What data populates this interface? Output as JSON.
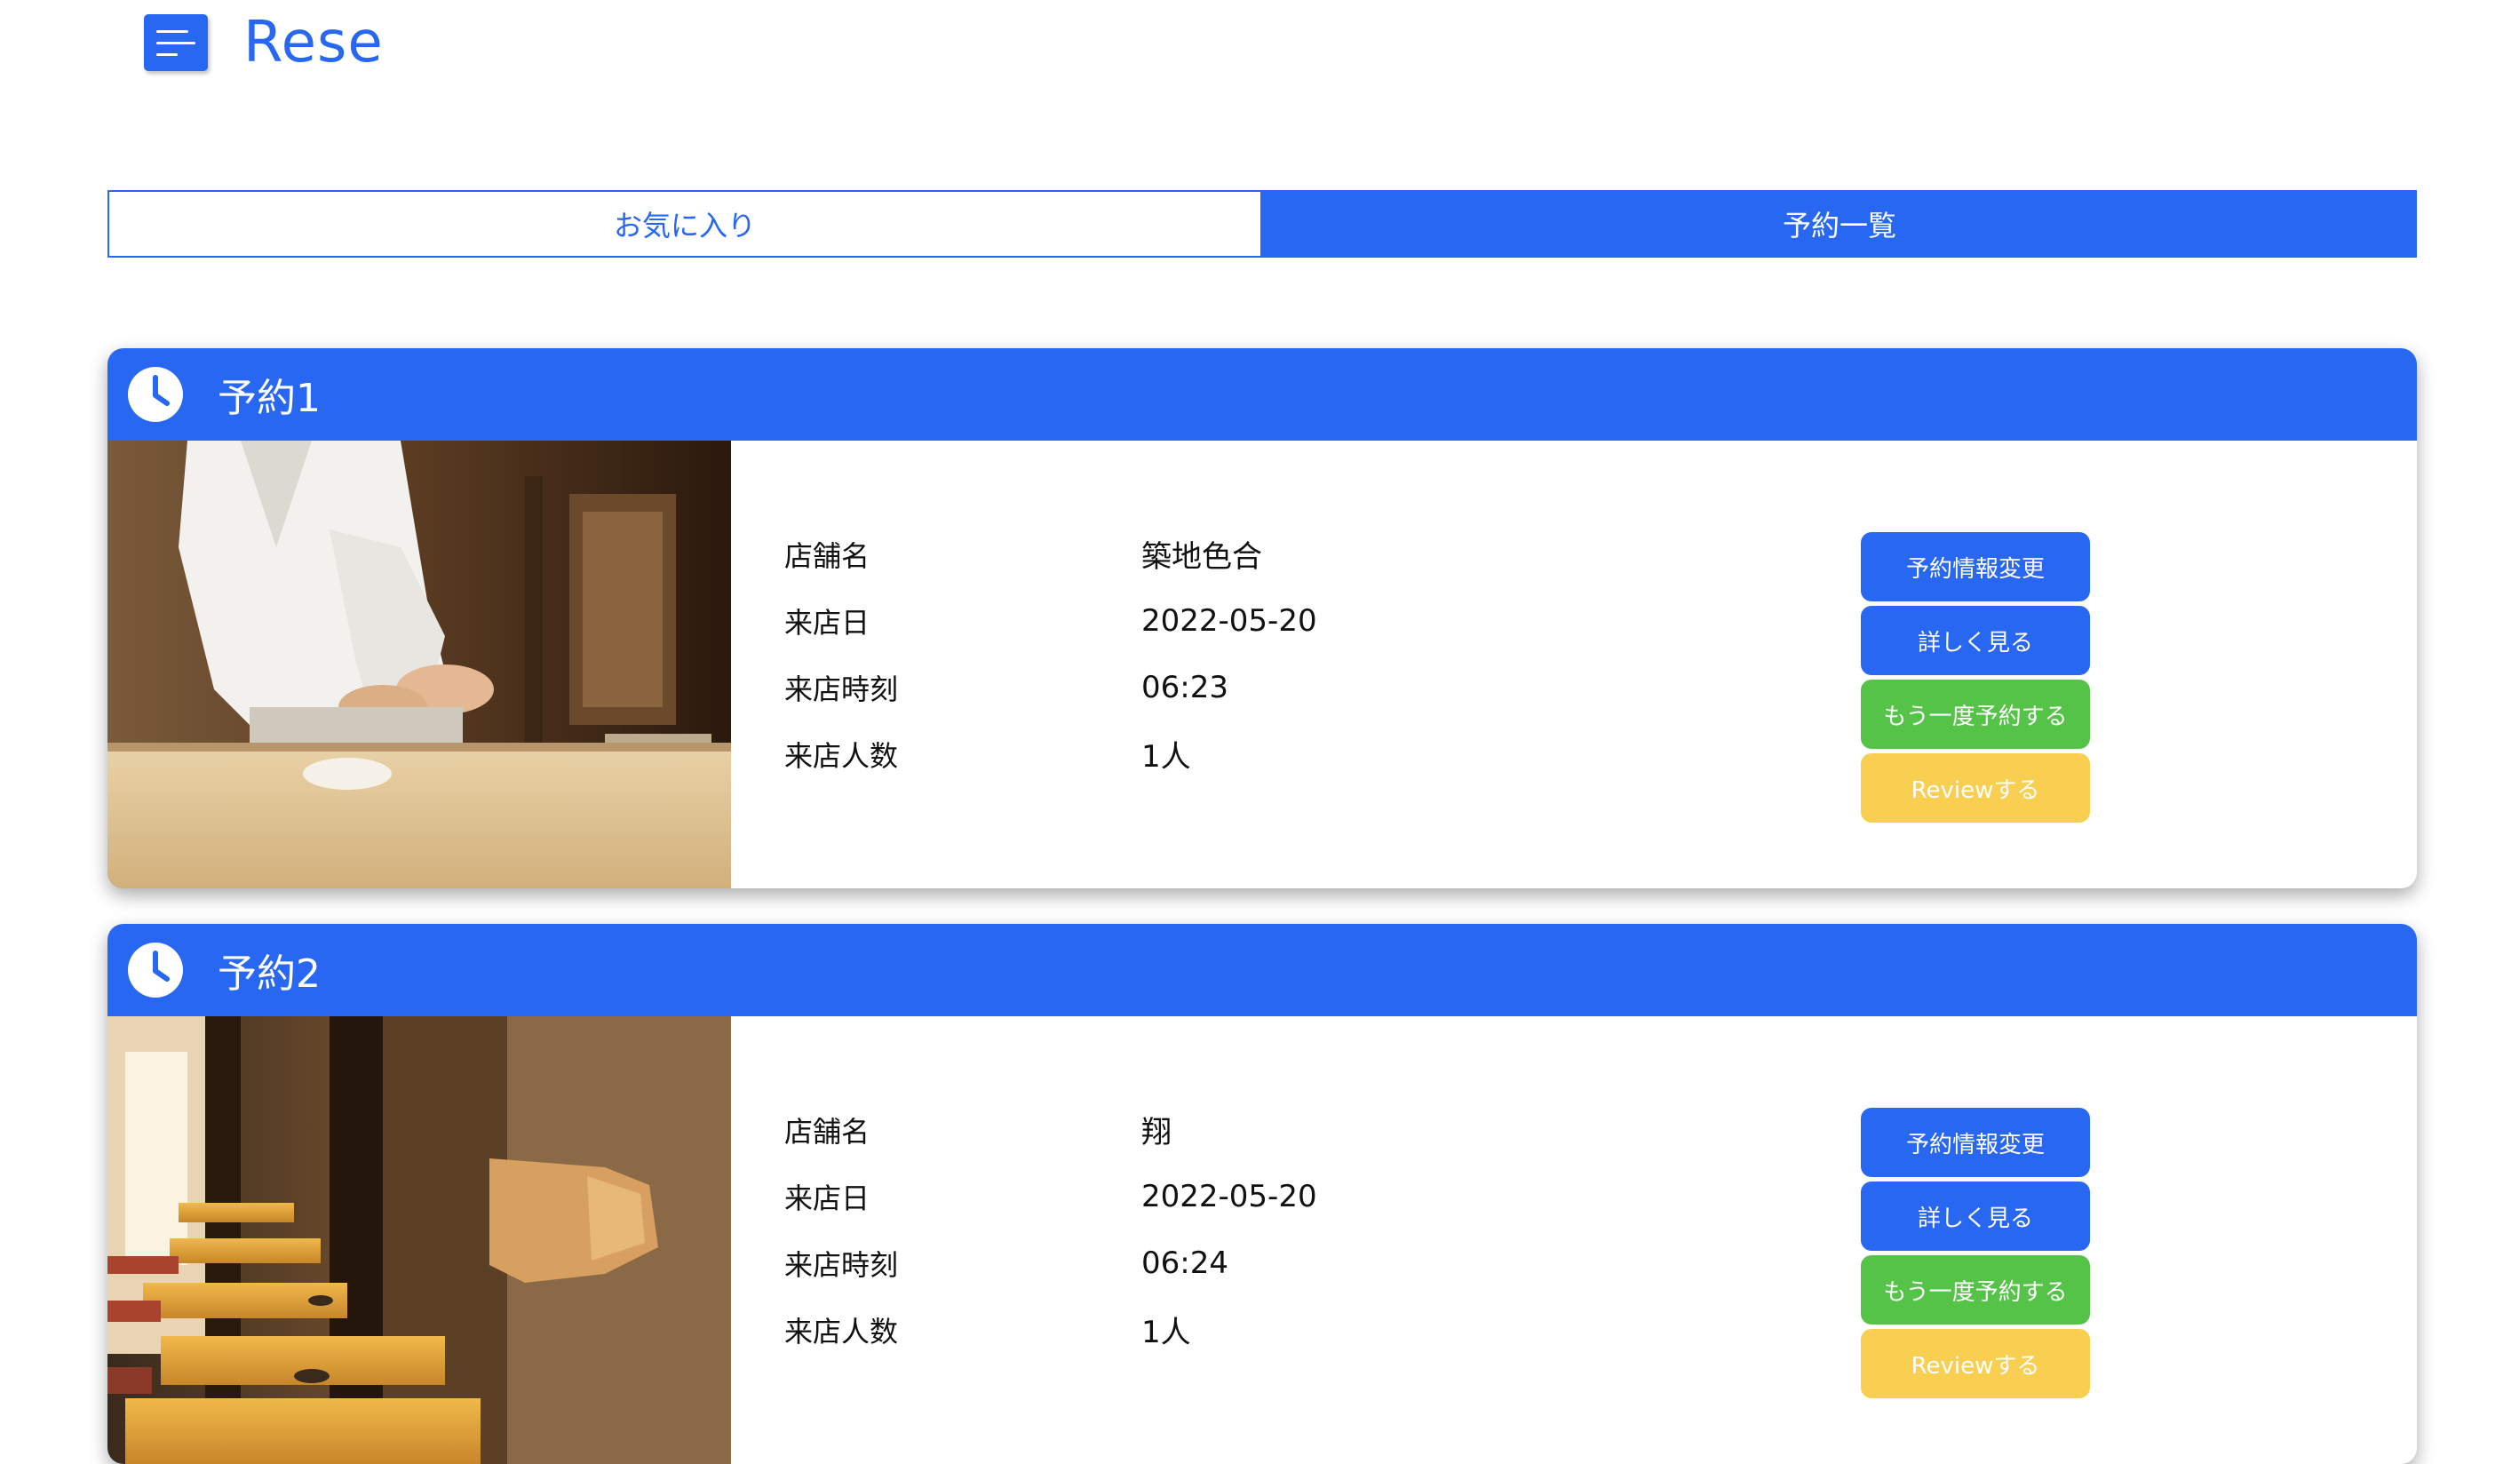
{
  "app": {
    "logo": "Rese"
  },
  "icons": {
    "menu": "menu-icon",
    "clock": "clock-icon"
  },
  "colors": {
    "primary": "#2767f1",
    "green": "#55c348",
    "yellow": "#f8cf50"
  },
  "tabs": [
    {
      "label": "お気に入り",
      "active": false
    },
    {
      "label": "予約一覧",
      "active": true
    }
  ],
  "labels": {
    "shop_name": "店舗名",
    "date": "来店日",
    "time": "来店時刻",
    "number": "来店人数"
  },
  "buttons": {
    "change": "予約情報変更",
    "detail": "詳しく見る",
    "rebook": "もう一度予約する",
    "review": "Reviewする"
  },
  "reservations": [
    {
      "title": "予約1",
      "shop": "築地色合",
      "date": "2022-05-20",
      "time": "06:23",
      "number": "1人"
    },
    {
      "title": "予約2",
      "shop": "翔",
      "date": "2022-05-20",
      "time": "06:24",
      "number": "1人"
    }
  ]
}
